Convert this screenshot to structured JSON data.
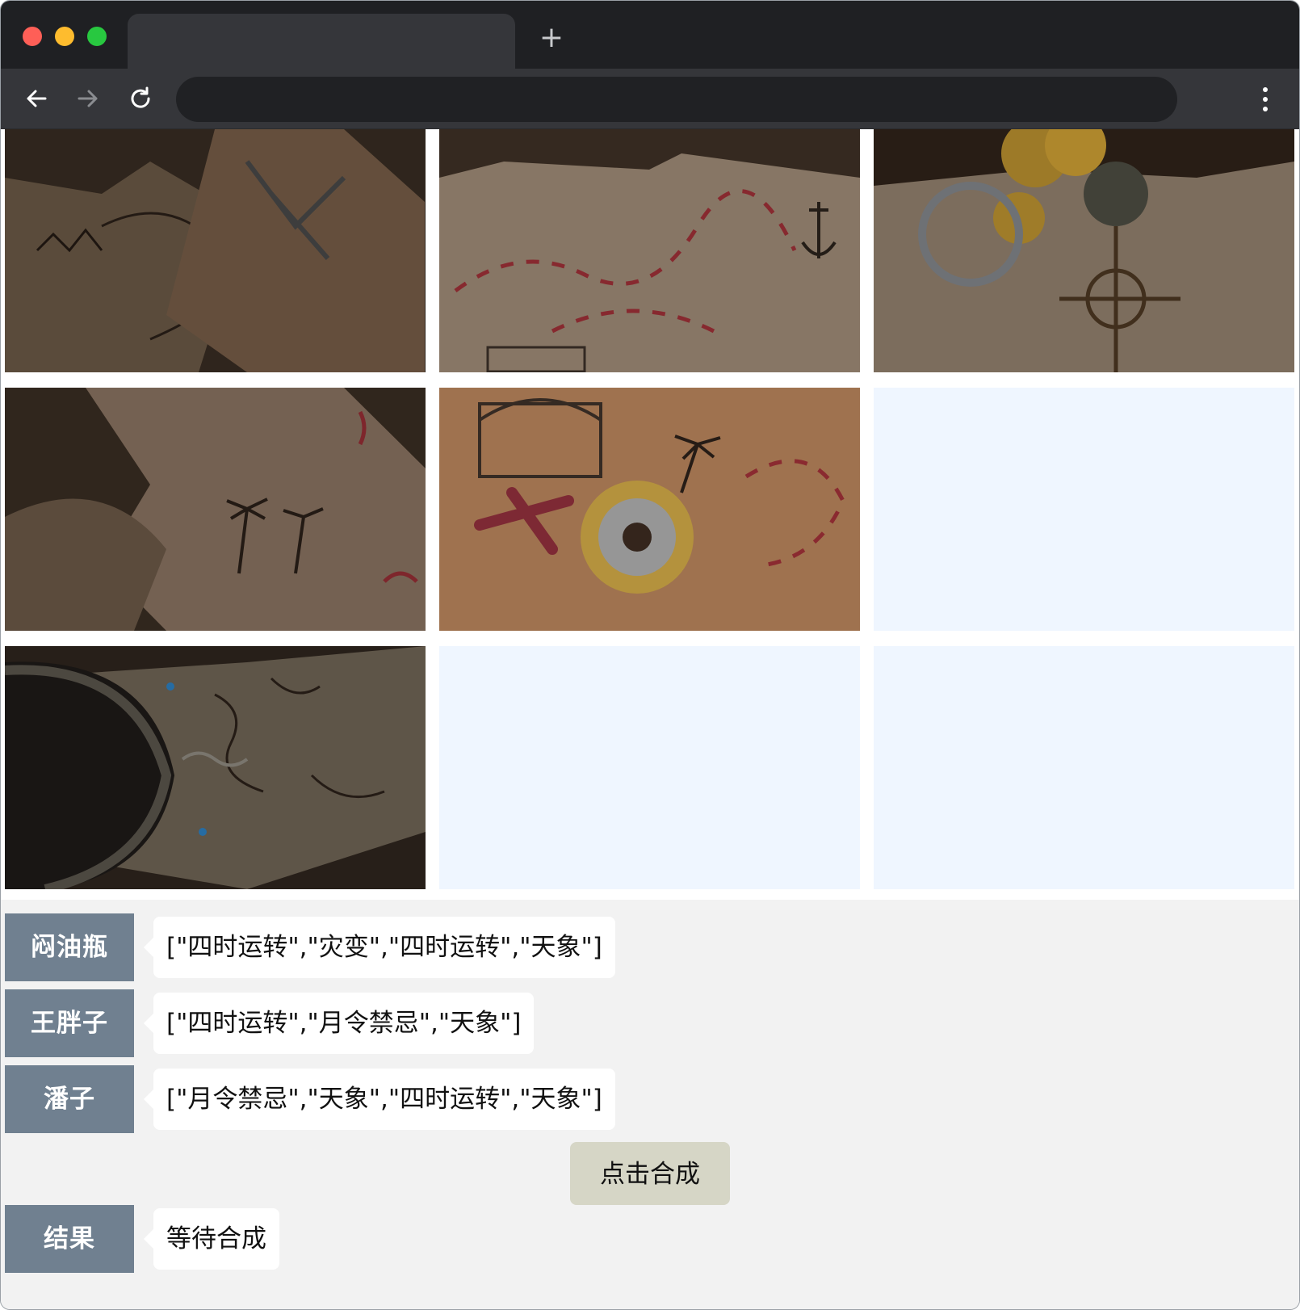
{
  "browser": {
    "new_tab_glyph": "+",
    "icons": [
      "back-arrow-icon",
      "forward-arrow-icon",
      "reload-icon",
      "more-vertical-icon"
    ]
  },
  "puzzle": {
    "cells": [
      {
        "state": "filled",
        "art": "rolled-map"
      },
      {
        "state": "filled",
        "art": "map-path-anchor"
      },
      {
        "state": "filled",
        "art": "ring-coins-compass"
      },
      {
        "state": "filled",
        "art": "torn-map-palms"
      },
      {
        "state": "filled",
        "art": "chest-coin-x"
      },
      {
        "state": "empty"
      },
      {
        "state": "filled",
        "art": "bracelet-map"
      },
      {
        "state": "empty"
      },
      {
        "state": "empty"
      }
    ],
    "empty_color": "#eff6ff"
  },
  "rows": [
    {
      "name": "闷油瓶",
      "value": "[\"四时运转\",\"灾变\",\"四时运转\",\"天象\"]"
    },
    {
      "name": "王胖子",
      "value": "[\"四时运转\",\"月令禁忌\",\"天象\"]"
    },
    {
      "name": "潘子",
      "value": "[\"月令禁忌\",\"天象\",\"四时运转\",\"天象\"]"
    }
  ],
  "synthesize_button": "点击合成",
  "result": {
    "name": "结果",
    "value": "等待合成"
  },
  "colors": {
    "badge": "#708090",
    "button": "#d6d6c6",
    "page_bg": "#f2f2f2"
  }
}
